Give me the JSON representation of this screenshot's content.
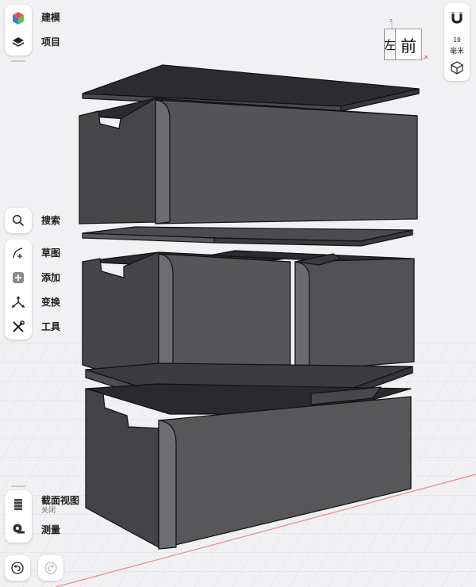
{
  "toolbar_top": [
    {
      "label": "建模",
      "icon": "modeling-cube-icon"
    },
    {
      "label": "项目",
      "icon": "layers-icon"
    }
  ],
  "toolbar_mid": {
    "search": {
      "label": "搜索",
      "icon": "search-icon"
    },
    "items": [
      {
        "label": "草图",
        "icon": "sketch-curve-icon"
      },
      {
        "label": "添加",
        "icon": "add-plus-icon"
      },
      {
        "label": "变换",
        "icon": "transform-arrows-icon"
      },
      {
        "label": "工具",
        "icon": "tools-wrench-icon"
      }
    ]
  },
  "toolbar_bottom": {
    "section_view": {
      "label": "截面视图",
      "status": "关闭",
      "icon": "section-view-icon"
    },
    "measure": {
      "label": "测量",
      "icon": "measure-tape-icon"
    }
  },
  "history": {
    "undo_icon": "undo-icon",
    "redo_icon": "redo-icon"
  },
  "right_panel": {
    "snap_icon": "magnet-icon",
    "grid_value": "10",
    "grid_unit": "毫米",
    "projection_icon": "perspective-cube-icon"
  },
  "view_cube": {
    "front": "前",
    "left": "左",
    "axis_z": "z",
    "axis_x": "x"
  },
  "colors": {
    "model": "#3f3f44",
    "background": "#f1f1f3",
    "accent_axis": "#d23030"
  }
}
